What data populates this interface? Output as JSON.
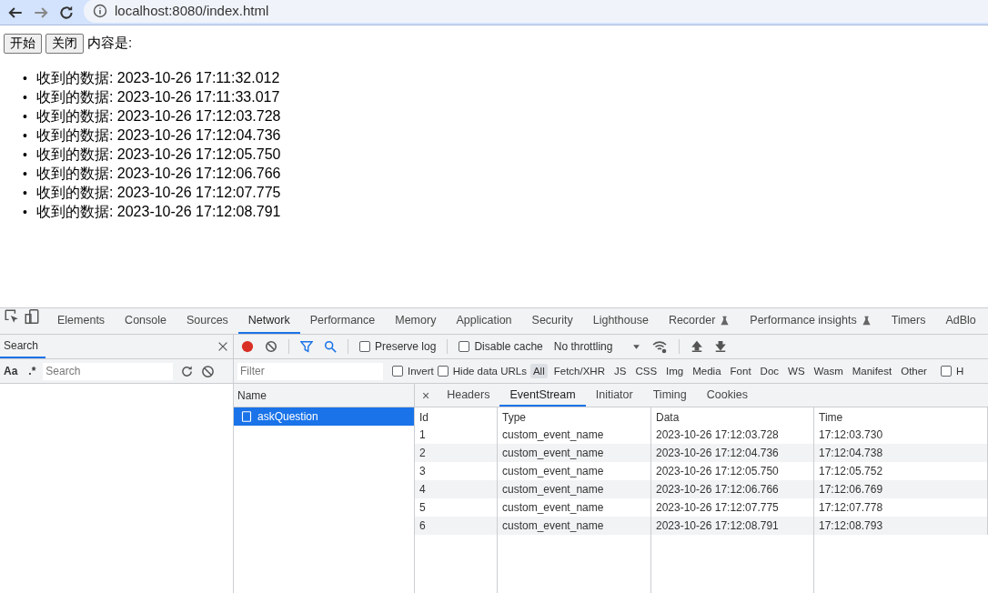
{
  "browser": {
    "url": "localhost:8080/index.html"
  },
  "page": {
    "buttons": [
      "开始",
      "关闭"
    ],
    "label": "内容是:",
    "marker": "•",
    "messages": [
      "收到的数据: 2023-10-26 17:11:32.012",
      "收到的数据: 2023-10-26 17:11:33.017",
      "收到的数据: 2023-10-26 17:12:03.728",
      "收到的数据: 2023-10-26 17:12:04.736",
      "收到的数据: 2023-10-26 17:12:05.750",
      "收到的数据: 2023-10-26 17:12:06.766",
      "收到的数据: 2023-10-26 17:12:07.775",
      "收到的数据: 2023-10-26 17:12:08.791"
    ]
  },
  "devtools": {
    "tabs": [
      {
        "label": "Elements",
        "selected": false,
        "kind": "plain"
      },
      {
        "label": "Console",
        "selected": false,
        "kind": "plain"
      },
      {
        "label": "Sources",
        "selected": false,
        "kind": "plain"
      },
      {
        "label": "Network",
        "selected": true,
        "kind": "plain"
      },
      {
        "label": "Performance",
        "selected": false,
        "kind": "plain"
      },
      {
        "label": "Memory",
        "selected": false,
        "kind": "plain"
      },
      {
        "label": "Application",
        "selected": false,
        "kind": "plain"
      },
      {
        "label": "Security",
        "selected": false,
        "kind": "plain"
      },
      {
        "label": "Lighthouse",
        "selected": false,
        "kind": "plain"
      },
      {
        "label": "Recorder",
        "selected": false,
        "kind": "experimental"
      },
      {
        "label": "Performance insights",
        "selected": false,
        "kind": "experimental"
      },
      {
        "label": "Timers",
        "selected": false,
        "kind": "plain"
      },
      {
        "label": "AdBlo",
        "selected": false,
        "kind": "plain"
      }
    ],
    "search_panel": {
      "tab": {
        "label": "Search",
        "selected": true
      },
      "case_toggle": "Aa",
      "regex_toggle": ".*",
      "placeholder": "Search"
    },
    "toolbar": {
      "preserve_log": {
        "label": "Preserve log",
        "checked": false
      },
      "disable_cache": {
        "label": "Disable cache",
        "checked": false
      },
      "throttling": "No throttling"
    },
    "filter_row": {
      "placeholder": "Filter",
      "invert": {
        "label": "Invert",
        "checked": false
      },
      "hide_data_urls": {
        "label": "Hide data URLs",
        "checked": false
      },
      "types": [
        {
          "label": "All",
          "selected": true
        },
        {
          "label": "Fetch/XHR",
          "selected": false
        },
        {
          "label": "JS",
          "selected": false
        },
        {
          "label": "CSS",
          "selected": false
        },
        {
          "label": "Img",
          "selected": false
        },
        {
          "label": "Media",
          "selected": false
        },
        {
          "label": "Font",
          "selected": false
        },
        {
          "label": "Doc",
          "selected": false
        },
        {
          "label": "WS",
          "selected": false
        },
        {
          "label": "Wasm",
          "selected": false
        },
        {
          "label": "Manifest",
          "selected": false
        },
        {
          "label": "Other",
          "selected": false
        }
      ],
      "last_checkbox": {
        "label": "H",
        "checked": false
      }
    },
    "requests": {
      "header": "Name",
      "items": [
        {
          "name": "askQuestion",
          "selected": true
        }
      ]
    },
    "detail": {
      "close": "×",
      "tabs": [
        {
          "label": "Headers",
          "selected": false
        },
        {
          "label": "EventStream",
          "selected": true
        },
        {
          "label": "Initiator",
          "selected": false
        },
        {
          "label": "Timing",
          "selected": false
        },
        {
          "label": "Cookies",
          "selected": false
        }
      ],
      "columns": [
        "Id",
        "Type",
        "Data",
        "Time"
      ],
      "rows": [
        [
          "1",
          "custom_event_name",
          "2023-10-26 17:12:03.728",
          "17:12:03.730"
        ],
        [
          "2",
          "custom_event_name",
          "2023-10-26 17:12:04.736",
          "17:12:04.738"
        ],
        [
          "3",
          "custom_event_name",
          "2023-10-26 17:12:05.750",
          "17:12:05.752"
        ],
        [
          "4",
          "custom_event_name",
          "2023-10-26 17:12:06.766",
          "17:12:06.769"
        ],
        [
          "5",
          "custom_event_name",
          "2023-10-26 17:12:07.775",
          "17:12:07.778"
        ],
        [
          "6",
          "custom_event_name",
          "2023-10-26 17:12:08.791",
          "17:12:08.793"
        ]
      ]
    }
  }
}
